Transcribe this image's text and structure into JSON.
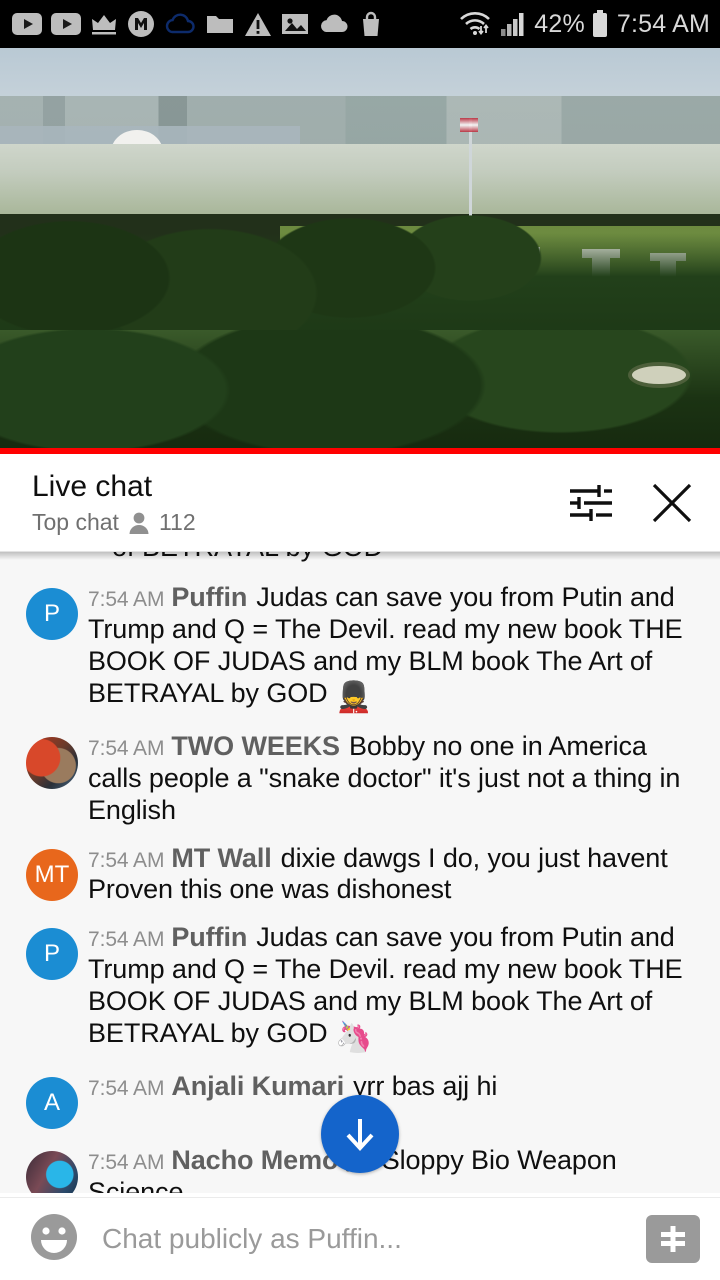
{
  "status_bar": {
    "left_icons": [
      {
        "name": "youtube-icon"
      },
      {
        "name": "youtube-icon"
      },
      {
        "name": "crown-icon"
      },
      {
        "name": "messenger-m-icon"
      },
      {
        "name": "cloud-outline-icon"
      },
      {
        "name": "folder-icon"
      },
      {
        "name": "warning-triangle-icon"
      },
      {
        "name": "image-icon"
      },
      {
        "name": "cloud-filled-icon"
      },
      {
        "name": "shopping-bag-icon"
      }
    ],
    "wifi_icon": "wifi-icon",
    "signal_icon": "cellular-signal-icon",
    "battery_percent": "42%",
    "battery_icon": "battery-icon",
    "clock": "7:54 AM"
  },
  "video": {
    "name": "live-video-player",
    "description": "White House live webcam",
    "progress_color": "#ff0000"
  },
  "chat_header": {
    "title": "Live chat",
    "subtitle": "Top chat",
    "viewer_count": "112",
    "person_icon": "person-icon",
    "settings_icon": "tune-sliders-icon",
    "close_icon": "close-x-icon"
  },
  "chat": {
    "clipped_top_text": "of BETRAYAL by GOD",
    "messages": [
      {
        "time": "7:54 AM",
        "author": "Puffin",
        "text": "Judas can save you from Putin and Trump and Q = The Devil. read my new book THE BOOK OF JUDAS and my BLM book The Art of BETRAYAL by GOD ",
        "emoji": "💂",
        "avatar_type": "initial",
        "avatar_initial": "P",
        "avatar_color": "#1b8dd3"
      },
      {
        "time": "7:54 AM",
        "author": "TWO WEEKS",
        "text": "Bobby no one in America calls people a \"snake doctor\" it's just not a thing in English",
        "emoji": "",
        "avatar_type": "photo-a",
        "avatar_initial": "",
        "avatar_color": "#b8351d"
      },
      {
        "time": "7:54 AM",
        "author": "MT Wall",
        "text": "dixie dawgs I do, you just havent Proven this one was dishonest",
        "emoji": "",
        "avatar_type": "initial",
        "avatar_initial": "MT",
        "avatar_color": "#e8671c"
      },
      {
        "time": "7:54 AM",
        "author": "Puffin",
        "text": "Judas can save you from Putin and Trump and Q = The Devil. read my new book THE BOOK OF JUDAS and my BLM book The Art of BETRAYAL by GOD ",
        "emoji": "🦄",
        "avatar_type": "initial",
        "avatar_initial": "P",
        "avatar_color": "#1b8dd3"
      },
      {
        "time": "7:54 AM",
        "author": "Anjali Kumari",
        "text": "yrr bas ajj hi",
        "emoji": "",
        "avatar_type": "initial",
        "avatar_initial": "A",
        "avatar_color": "#1b8dd3"
      },
      {
        "time": "7:54 AM",
        "author": "Nacho Memo 》",
        "text": "Sloppy Bio Weapon Science",
        "emoji": "",
        "avatar_type": "photo-b",
        "avatar_initial": "",
        "avatar_color": "#2b4a6b"
      }
    ],
    "scroll_button_icon": "arrow-down-icon",
    "scroll_button_color": "#1464cb"
  },
  "input_bar": {
    "emoji_icon": "emoji-smiley-icon",
    "placeholder": "Chat publicly as Puffin...",
    "value": "",
    "superchat_icon": "dollar-superchat-icon"
  }
}
